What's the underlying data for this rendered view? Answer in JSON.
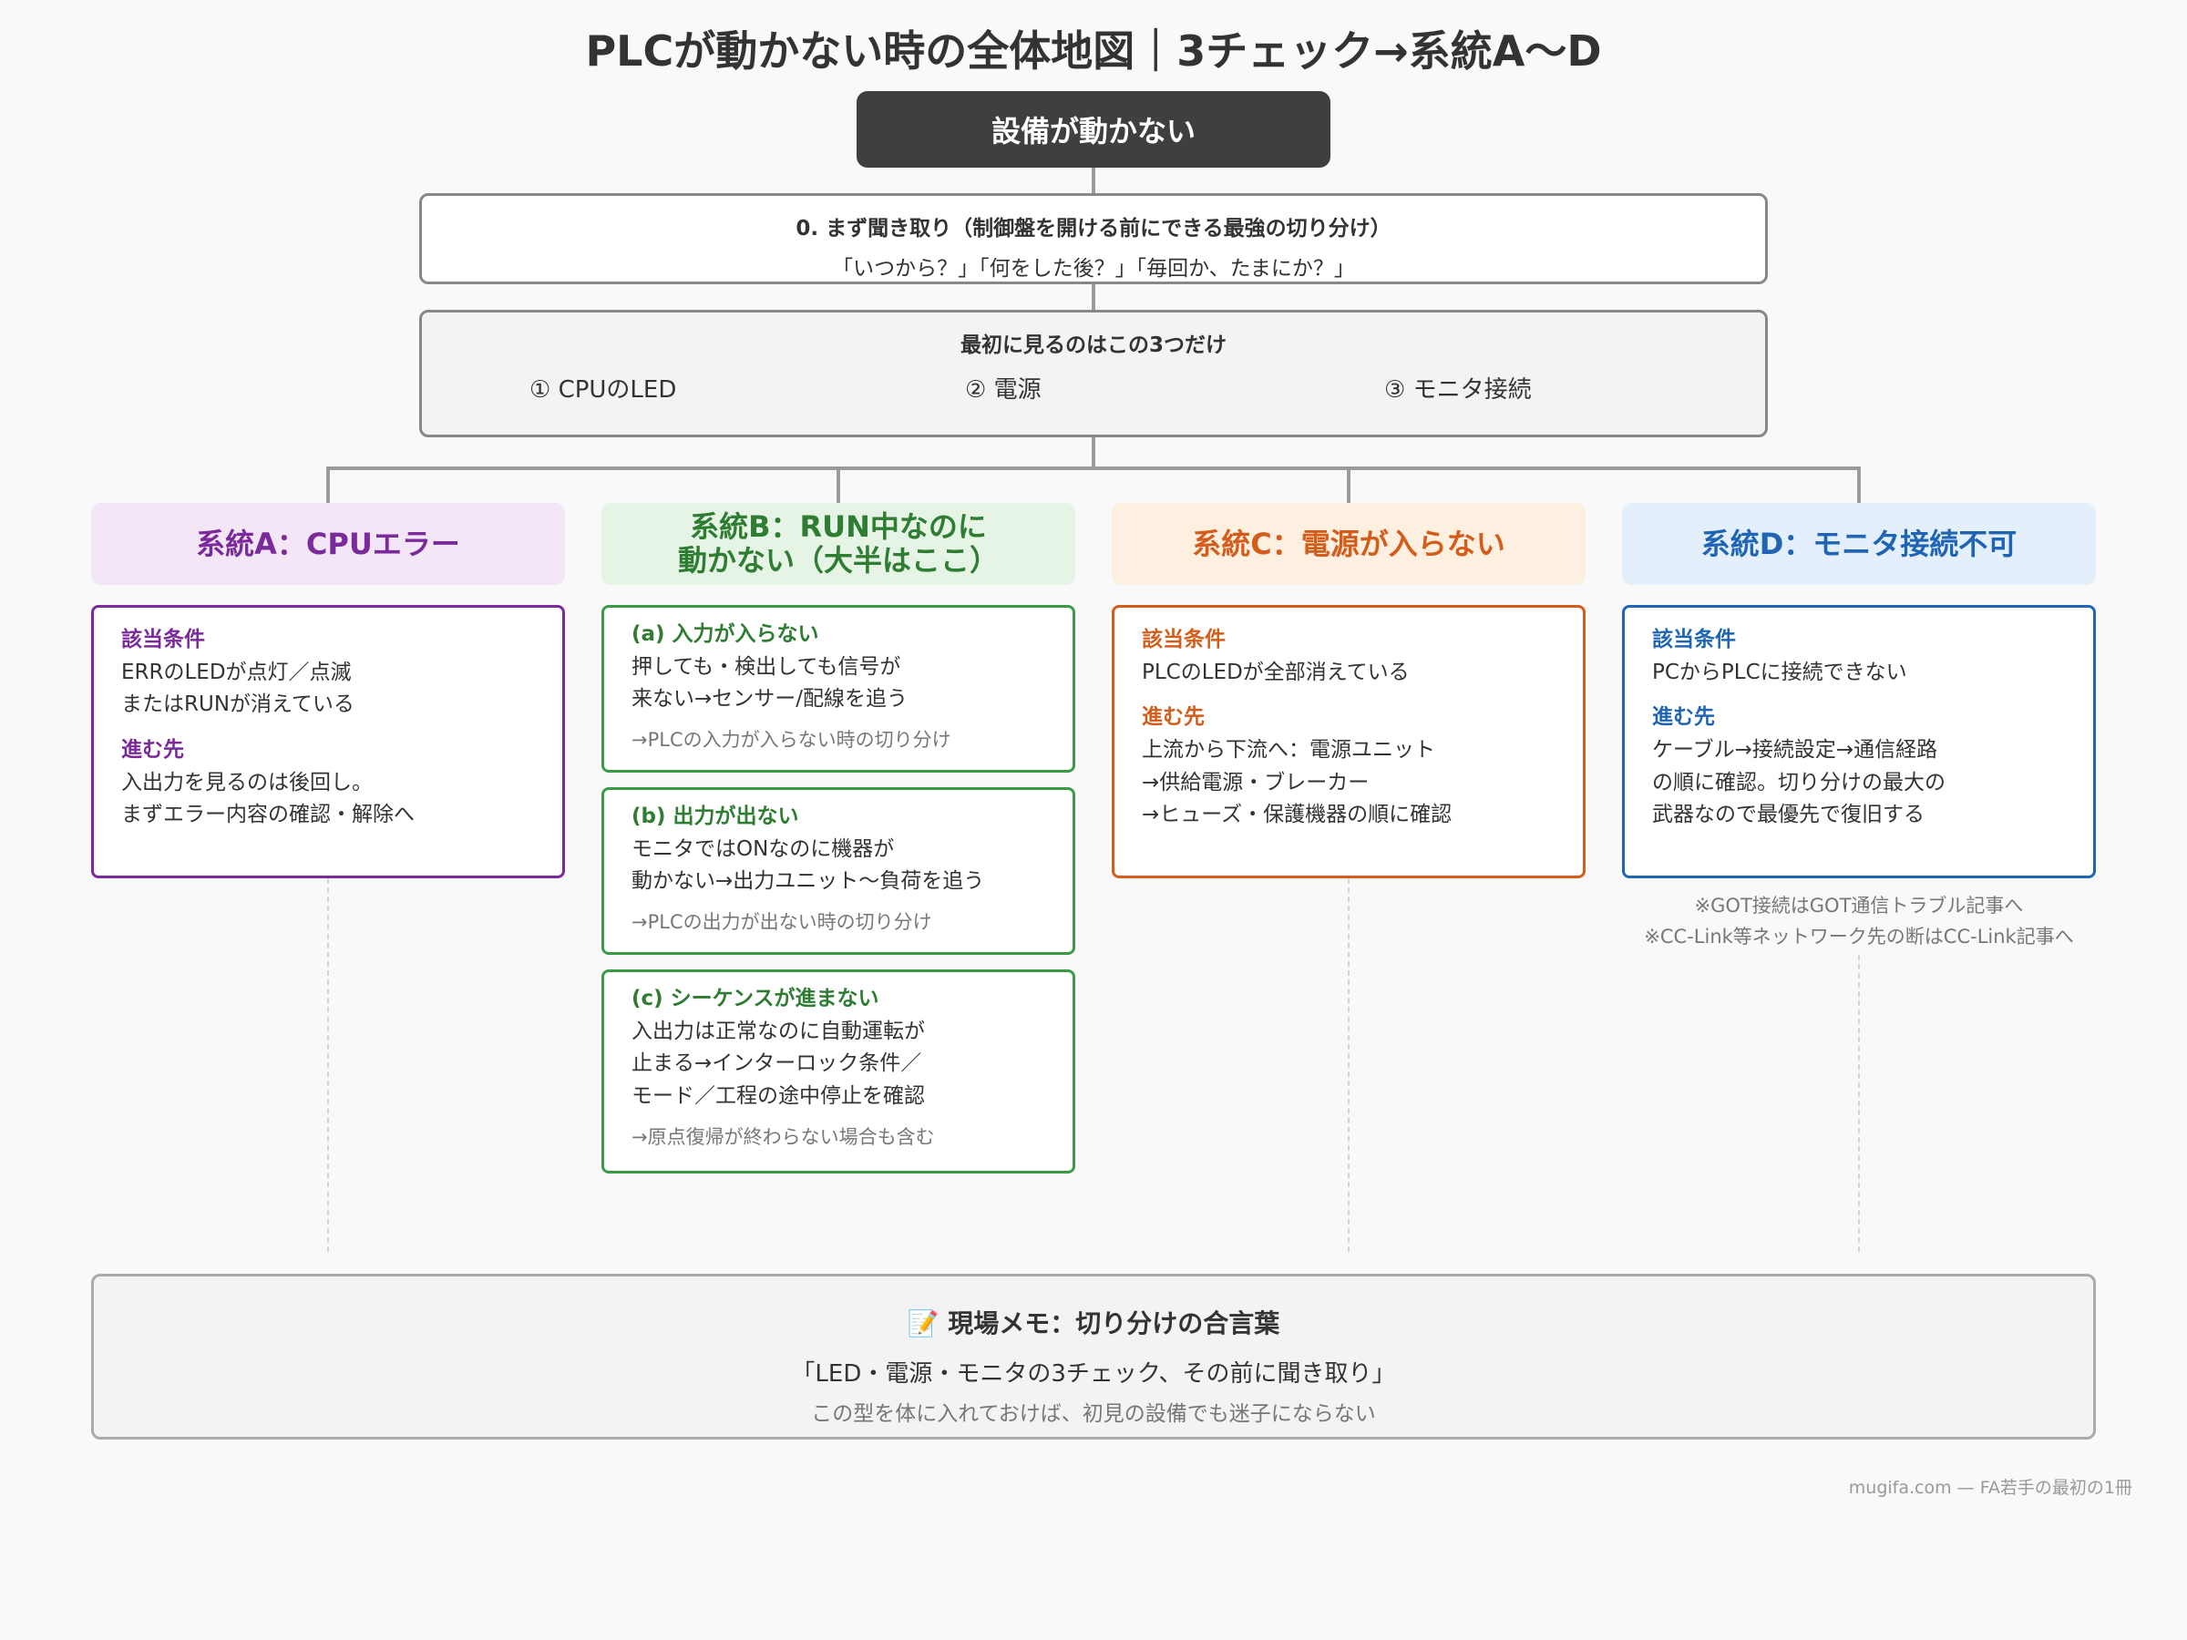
{
  "title": "PLCが動かない時の全体地図｜3チェック→系統A〜D",
  "root": "設備が動かない",
  "step0": {
    "heading": "0. まず聞き取り（制御盤を開ける前にできる最強の切り分け）",
    "questions": "「いつから？」「何をした後？」「毎回か、たまにか？」"
  },
  "checks": {
    "heading": "最初に見るのはこの3つだけ",
    "items": [
      "① CPUのLED",
      "② 電源",
      "③ モニタ接続"
    ]
  },
  "branch_a": {
    "title": "系統A：CPUエラー",
    "cond_label": "該当条件",
    "cond_lines": [
      "ERRのLEDが点灯／点滅",
      "またはRUNが消えている"
    ],
    "next_label": "進む先",
    "next_lines": [
      "入出力を見るのは後回し。",
      "まずエラー内容の確認・解除へ"
    ]
  },
  "branch_b": {
    "title_lines": [
      "系統B：RUN中なのに",
      "動かない（大半はここ）"
    ],
    "cards": [
      {
        "title": "(a) 入力が入らない",
        "lines": [
          "押しても・検出しても信号が",
          "来ない→センサー/配線を追う"
        ],
        "note": "→PLCの入力が入らない時の切り分け"
      },
      {
        "title": "(b) 出力が出ない",
        "lines": [
          "モニタではONなのに機器が",
          "動かない→出力ユニット〜負荷を追う"
        ],
        "note": "→PLCの出力が出ない時の切り分け"
      },
      {
        "title": "(c) シーケンスが進まない",
        "lines": [
          "入出力は正常なのに自動運転が",
          "止まる→インターロック条件／",
          "モード／工程の途中停止を確認"
        ],
        "note": "→原点復帰が終わらない場合も含む"
      }
    ]
  },
  "branch_c": {
    "title": "系統C：電源が入らない",
    "cond_label": "該当条件",
    "cond_lines": [
      "PLCのLEDが全部消えている"
    ],
    "next_label": "進む先",
    "next_lines": [
      "上流から下流へ：電源ユニット",
      "→供給電源・ブレーカー",
      "→ヒューズ・保護機器の順に確認"
    ]
  },
  "branch_d": {
    "title": "系統D：モニタ接続不可",
    "cond_label": "該当条件",
    "cond_lines": [
      "PCからPLCに接続できない"
    ],
    "next_label": "進む先",
    "next_lines": [
      "ケーブル→接続設定→通信経路",
      "の順に確認。切り分けの最大の",
      "武器なので最優先で復旧する"
    ],
    "notes": [
      "※GOT接続はGOT通信トラブル記事へ",
      "※CC-Link等ネットワーク先の断はCC-Link記事へ"
    ]
  },
  "memo": {
    "icon": "📝",
    "heading": "現場メモ：切り分けの合言葉",
    "phrase": "「LED・電源・モニタの3チェック、その前に聞き取り」",
    "sub": "この型を体に入れておけば、初見の設備でも迷子にならない"
  },
  "footer": "mugifa.com — FA若手の最初の1冊",
  "colors": {
    "a": "#7b2a9b",
    "b": "#2e7d32",
    "c": "#d35d1b",
    "d": "#1f65b3",
    "root_bg": "#3f3f3f"
  }
}
